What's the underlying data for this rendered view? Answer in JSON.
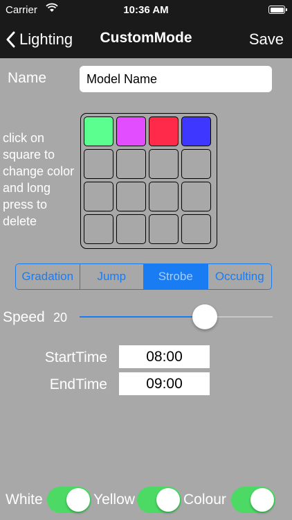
{
  "status_bar": {
    "carrier": "Carrier",
    "time": "10:36 AM"
  },
  "nav": {
    "back_label": "Lighting",
    "title": "CustomMode",
    "save_label": "Save"
  },
  "name_field": {
    "label": "Name",
    "value": "Model Name"
  },
  "instructions": "click on square to change color and long press to delete",
  "color_grid": {
    "colors": [
      "#5bff8f",
      "#e24dff",
      "#ff2a4a",
      "#3d37ff",
      "",
      "",
      "",
      "",
      "",
      "",
      "",
      "",
      "",
      "",
      "",
      ""
    ]
  },
  "modes": {
    "options": [
      "Gradation",
      "Jump",
      "Strobe",
      "Occulting"
    ],
    "selected": "Strobe",
    "accent_color": "#1a7cf2"
  },
  "speed": {
    "label": "Speed",
    "value": "20",
    "fraction": 0.65
  },
  "times": {
    "start_label": "StartTime",
    "start_value": "08:00",
    "end_label": "EndTime",
    "end_value": "09:00"
  },
  "toggles": [
    {
      "label": "White",
      "on": true
    },
    {
      "label": "Yellow",
      "on": true
    },
    {
      "label": "Colour",
      "on": true
    }
  ],
  "toggle_on_color": "#4cd964"
}
